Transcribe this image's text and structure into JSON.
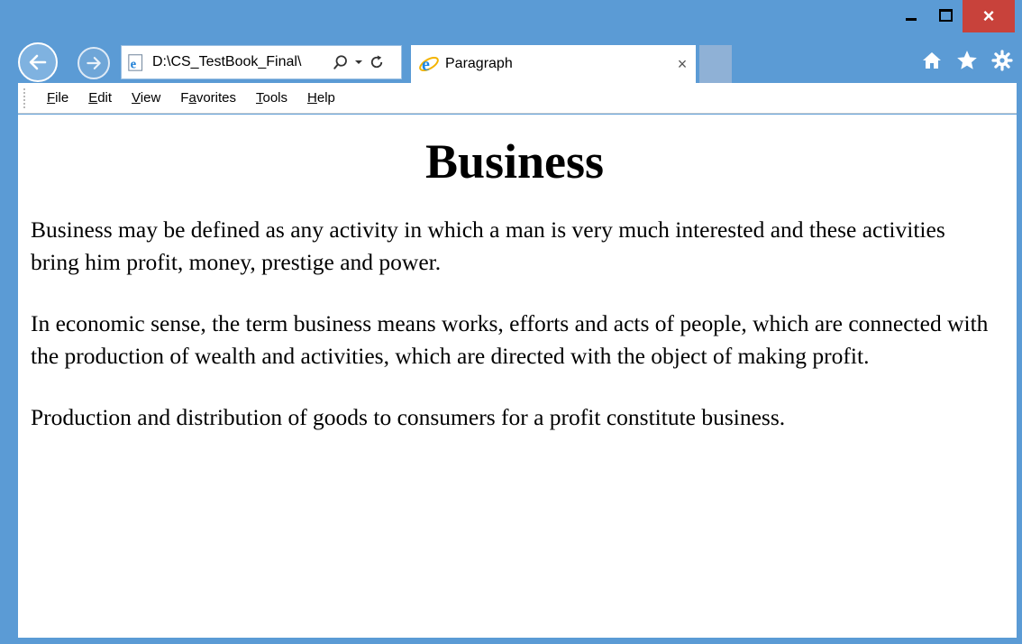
{
  "window": {
    "close_glyph": "×",
    "accent": "#5b9bd5",
    "close_color": "#c8423b"
  },
  "nav": {
    "back_icon": "back-arrow-icon",
    "forward_icon": "forward-arrow-icon"
  },
  "address_bar": {
    "value": "D:\\CS_TestBook_Final\\",
    "search_icon": "search-icon",
    "dropdown_icon": "dropdown-icon",
    "refresh_icon": "refresh-icon"
  },
  "tabs": [
    {
      "title": "Paragraph",
      "close": "×"
    }
  ],
  "toolbar_right": [
    "home-icon",
    "favorites-star-icon",
    "settings-gear-icon"
  ],
  "menubar": {
    "items": [
      {
        "pre": "",
        "u": "F",
        "post": "ile"
      },
      {
        "pre": "",
        "u": "E",
        "post": "dit"
      },
      {
        "pre": "",
        "u": "V",
        "post": "iew"
      },
      {
        "pre": "F",
        "u": "a",
        "post": "vorites"
      },
      {
        "pre": "",
        "u": "T",
        "post": "ools"
      },
      {
        "pre": "",
        "u": "H",
        "post": "elp"
      }
    ]
  },
  "page": {
    "heading": "Business",
    "paragraphs": [
      "Business may be defined as any activity in which a man is very much interested and these activities bring him profit, money, prestige and power.",
      "In economic sense, the term business means works, efforts and acts of people, which are connected with the production of wealth and activities, which are directed with the object of making profit.",
      "Production and distribution of goods to consumers for a profit constitute business."
    ]
  }
}
